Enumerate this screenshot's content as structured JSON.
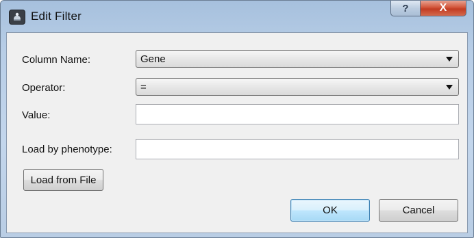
{
  "window": {
    "title": "Edit Filter",
    "help_label": "?",
    "close_label": "X"
  },
  "form": {
    "column_name": {
      "label": "Column Name:",
      "value": "Gene"
    },
    "operator": {
      "label": "Operator:",
      "value": "="
    },
    "value_field": {
      "label": "Value:",
      "value": "",
      "placeholder": ""
    },
    "phenotype_field": {
      "label": "Load by phenotype:",
      "value": "",
      "placeholder": ""
    }
  },
  "buttons": {
    "load_from_file": "Load from File",
    "ok": "OK",
    "cancel": "Cancel"
  },
  "colors": {
    "titlebar": "#b7cde6",
    "close_button": "#c13c22",
    "default_button_border": "#3c7fb1",
    "dialog_background": "#f0f0f0"
  }
}
